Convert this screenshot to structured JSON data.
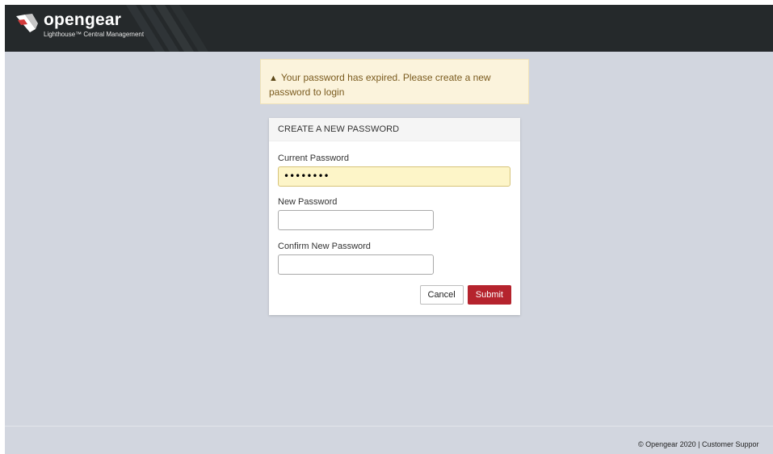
{
  "header": {
    "brand": "opengear",
    "tagline": "Lighthouse™ Central Management",
    "bg_color": "#25292b"
  },
  "alert": {
    "icon": "warning-triangle-icon",
    "message": "Your password has expired. Please create a new password to login",
    "bg_color": "#fbf3dc"
  },
  "form": {
    "title": "CREATE A NEW PASSWORD",
    "current_password": {
      "label": "Current Password",
      "value": "••••••••"
    },
    "new_password": {
      "label": "New Password",
      "value": ""
    },
    "confirm_password": {
      "label": "Confirm New Password",
      "value": ""
    },
    "cancel_label": "Cancel",
    "submit_label": "Submit",
    "submit_color": "#b5232d"
  },
  "footer": {
    "text": "© Opengear 2020 | Customer Suppor"
  }
}
